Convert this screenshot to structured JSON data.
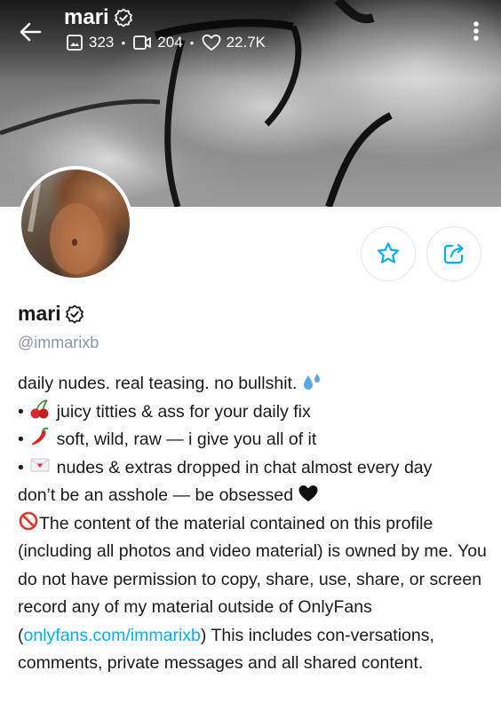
{
  "header": {
    "name": "mari",
    "stats": {
      "photos": "323",
      "videos": "204",
      "likes": "22.7K"
    }
  },
  "profile": {
    "name": "mari",
    "handle": "@immarixb"
  },
  "bio": {
    "line1": "daily nudes. real teasing. no bullshit.",
    "bullet1": "juicy titties & ass for your daily fix",
    "bullet2": "soft, wild, raw — i give you all of it",
    "bullet3": "nudes & extras dropped in chat almost every day",
    "line5": "don’t be an asshole — be obsessed",
    "notice_part1": "The content of the material contained on this profile (including all photos and video material) is owned by me. You do not have permission to copy, share, use, share, or screen record any of my material outside of OnlyFans (",
    "notice_link": "onlyfans.com/immarixb",
    "notice_part2": ") This includes con-versations, comments, private messages and all shared content."
  },
  "colors": {
    "accent": "#00aff0",
    "muted": "#8a96a3",
    "text": "#1a1a1a"
  },
  "icons": {
    "back": "arrow-left-icon",
    "verified": "verified-badge-icon",
    "photos": "image-icon",
    "videos": "video-icon",
    "likes": "heart-icon",
    "more": "more-vertical-icon",
    "favorite": "star-icon",
    "share": "share-icon"
  }
}
